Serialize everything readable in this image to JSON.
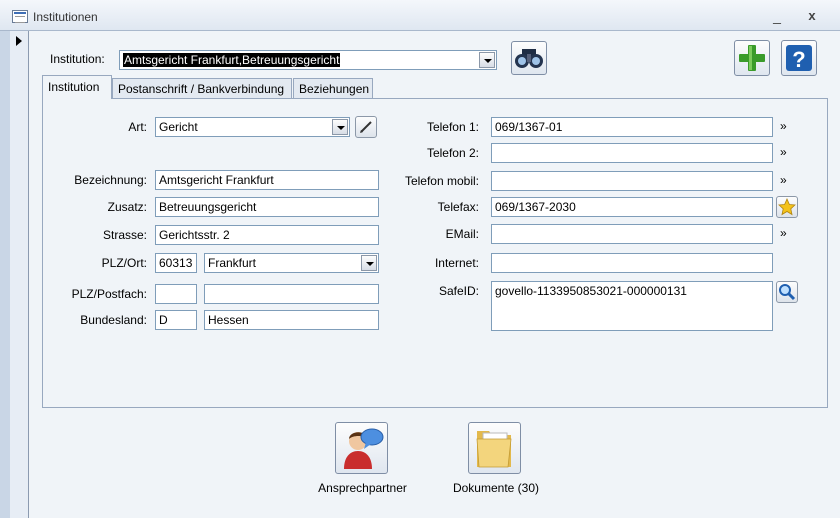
{
  "window": {
    "title": "Institutionen",
    "minimize": "_",
    "close": "x"
  },
  "header": {
    "institution_label": "Institution:",
    "institution_value": "Amtsgericht Frankfurt,Betreuungsgericht"
  },
  "tabs": [
    {
      "label": "Institution",
      "active": true
    },
    {
      "label": "Postanschrift / Bankverbindung",
      "active": false
    },
    {
      "label": "Beziehungen",
      "active": false
    }
  ],
  "left": {
    "art": {
      "label": "Art:",
      "value": "Gericht"
    },
    "bezeichnung": {
      "label": "Bezeichnung:",
      "value": "Amtsgericht Frankfurt"
    },
    "zusatz": {
      "label": "Zusatz:",
      "value": "Betreuungsgericht"
    },
    "strasse": {
      "label": "Strasse:",
      "value": "Gerichtsstr. 2"
    },
    "plzort": {
      "label": "PLZ/Ort:",
      "plz": "60313",
      "ort": "Frankfurt"
    },
    "postfach": {
      "label": "PLZ/Postfach:",
      "plz": "",
      "postfach": ""
    },
    "bundesland": {
      "label": "Bundesland:",
      "code": "D",
      "name": "Hessen"
    }
  },
  "right": {
    "telefon1": {
      "label": "Telefon 1:",
      "value": "069/1367-01"
    },
    "telefon2": {
      "label": "Telefon 2:",
      "value": ""
    },
    "mobil": {
      "label": "Telefon mobil:",
      "value": ""
    },
    "telefax": {
      "label": "Telefax:",
      "value": "069/1367-2030"
    },
    "email": {
      "label": "EMail:",
      "value": ""
    },
    "internet": {
      "label": "Internet:",
      "value": ""
    },
    "safeid": {
      "label": "SafeID:",
      "value": "govello-1133950853021-000000131"
    },
    "chevron": "»"
  },
  "footer": {
    "ansprechpartner": "Ansprechpartner",
    "dokumente": "Dokumente (30)"
  },
  "colors": {
    "accent_green": "#3a9b2a",
    "help_blue": "#1f5fb0",
    "selection": "#000000"
  }
}
